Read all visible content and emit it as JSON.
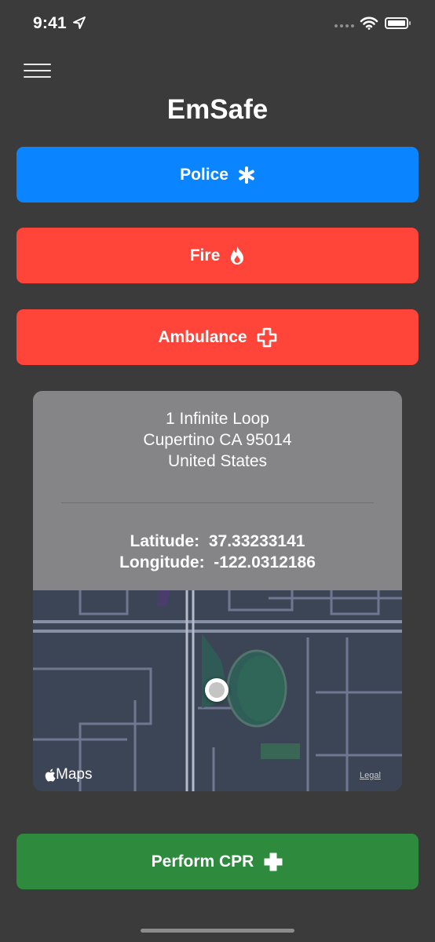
{
  "status_bar": {
    "time": "9:41",
    "icons": [
      "location-arrow-icon",
      "cellular-signal-icon",
      "wifi-icon",
      "battery-icon"
    ]
  },
  "header": {
    "title": "EmSafe",
    "menu_icon": "hamburger-menu-icon"
  },
  "emergency_buttons": [
    {
      "label": "Police",
      "icon": "asterisk-icon",
      "color": "#0a84ff"
    },
    {
      "label": "Fire",
      "icon": "flame-icon",
      "color": "#ff453a"
    },
    {
      "label": "Ambulance",
      "icon": "cross-outline-icon",
      "color": "#ff453a"
    }
  ],
  "location": {
    "address_lines": [
      "1 Infinite Loop",
      "Cupertino CA 95014",
      "United States"
    ],
    "latitude_label": "Latitude:",
    "latitude": "37.33233141",
    "longitude_label": "Longitude:",
    "longitude": "-122.0312186",
    "map_attribution": "Maps",
    "legal_label": "Legal"
  },
  "cpr_button": {
    "label": "Perform CPR",
    "icon": "plus-cross-icon",
    "color": "#2e8b3e"
  }
}
